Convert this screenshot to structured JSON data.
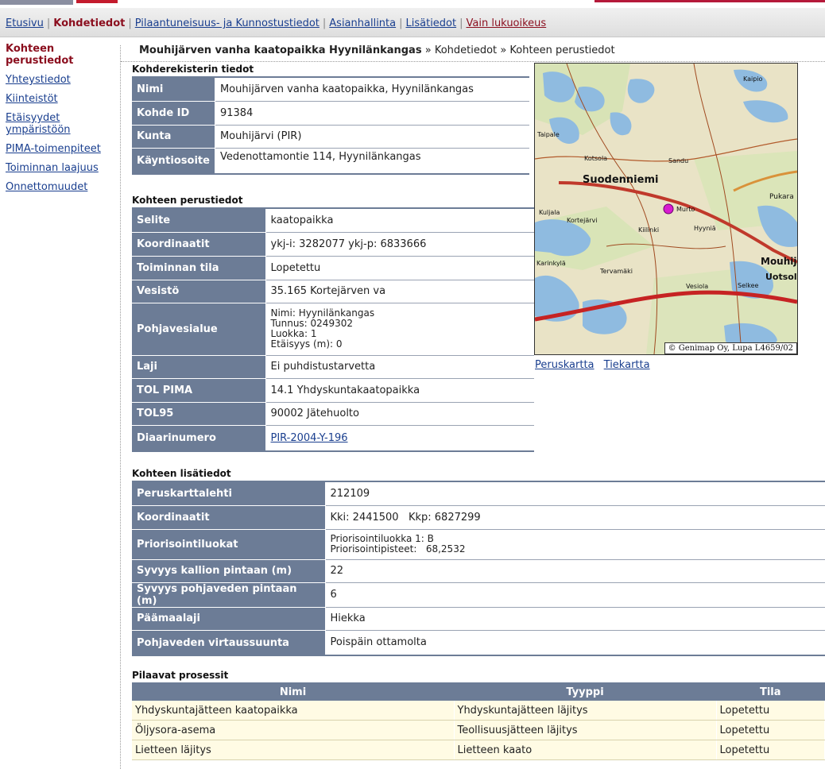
{
  "nav": {
    "items": [
      {
        "label": "Etusivu",
        "current": false
      },
      {
        "label": "Kohdetiedot",
        "current": true
      },
      {
        "label": "Pilaantuneisuus- ja Kunnostustiedot",
        "current": false
      },
      {
        "label": "Asianhallinta",
        "current": false
      },
      {
        "label": "Lisätiedot",
        "current": false
      },
      {
        "label": "Vain lukuoikeus",
        "current": false
      }
    ]
  },
  "sidebar": {
    "items": [
      {
        "label": "Kohteen perustiedot"
      },
      {
        "label": "Yhteystiedot"
      },
      {
        "label": "Kiinteistöt"
      },
      {
        "label": "Etäisyydet ympäristöön"
      },
      {
        "label": "PIMA-toimenpiteet"
      },
      {
        "label": "Toiminnan laajuus"
      },
      {
        "label": "Onnettomuudet"
      }
    ]
  },
  "breadcrumb": {
    "site": "Mouhijärven vanha kaatopaikka Hyynilänkangas",
    "sep": "»",
    "level1": "Kohdetiedot",
    "level2": "Kohteen perustiedot"
  },
  "register": {
    "title": "Kohderekisterin tiedot",
    "rows": [
      {
        "label": "Nimi",
        "value": "Mouhijärven vanha kaatopaikka, Hyynilänkangas"
      },
      {
        "label": "Kohde ID",
        "value": "91384"
      },
      {
        "label": "Kunta",
        "value": "Mouhijärvi (PIR)"
      },
      {
        "label": "Käyntiosoite",
        "value": "Vedenottamontie 114, Hyynilänkangas"
      }
    ]
  },
  "basic": {
    "title": "Kohteen perustiedot",
    "rows": [
      {
        "label": "Selite",
        "value": "kaatopaikka"
      },
      {
        "label": "Koordinaatit",
        "value": "ykj-i: 3282077 ykj-p: 6833666"
      },
      {
        "label": "Toiminnan tila",
        "value": "Lopetettu"
      },
      {
        "label": "Vesistö",
        "value": "35.165 Kortejärven va"
      },
      {
        "label": "Pohjavesialue",
        "lines": [
          "Nimi: Hyynilänkangas",
          "Tunnus: 0249302",
          "Luokka: 1",
          "Etäisyys (m): 0"
        ]
      },
      {
        "label": "Laji",
        "value": "Ei puhdistustarvetta"
      },
      {
        "label": "TOL PIMA",
        "value": "14.1 Yhdyskuntakaatopaikka"
      },
      {
        "label": "TOL95",
        "value": "90002 Jätehuolto"
      },
      {
        "label": "Diaarinumero",
        "value": "PIR-2004-Y-196"
      }
    ]
  },
  "map": {
    "copyright": "© Genimap Oy, Lupa L4659/02",
    "place_names": [
      "Suodenniemi",
      "Mouhijä",
      "Uotsola",
      "Kaipio",
      "Taipale",
      "Kortejärvi",
      "Tervamäki",
      "Hyyniä",
      "Karinkylä",
      "Vesiola",
      "Kiilinki",
      "Sandu",
      "Kotsola",
      "Selkee",
      "Kuljala",
      "Murto",
      "Pukara"
    ],
    "links": [
      "Peruskartta",
      "Tiekartta"
    ]
  },
  "extra": {
    "title": "Kohteen lisätiedot",
    "rows": [
      {
        "label": "Peruskarttalehti",
        "value": "212109"
      },
      {
        "label": "Koordinaatit",
        "value": "Kki: 2441500   Kkp: 6827299"
      },
      {
        "label": "Priorisointiluokat",
        "lines": [
          "Priorisointiluokka 1: B",
          "Priorisointipisteet:   68,2532"
        ]
      },
      {
        "label": "Syvyys kallion pintaan (m)",
        "value": "22"
      },
      {
        "label": "Syvyys pohjaveden pintaan (m)",
        "value": "6"
      },
      {
        "label": "Päämaalaji",
        "value": "Hiekka"
      },
      {
        "label": "Pohjaveden virtaussuunta",
        "value": "Poispäin ottamolta"
      }
    ]
  },
  "processes": {
    "title": "Pilaavat prosessit",
    "headers": [
      "Nimi",
      "Tyyppi",
      "Tila"
    ],
    "rows": [
      [
        "Yhdyskuntajätteen kaatopaikka",
        "Yhdyskuntajätteen läjitys",
        "Lopetettu"
      ],
      [
        "Öljysora-asema",
        "Teollisuusjätteen läjitys",
        "Lopetettu"
      ],
      [
        "Lietteen läjitys",
        "Lietteen kaato",
        "Lopetettu"
      ]
    ]
  },
  "colors": {
    "accent": "#8b0e1e",
    "header_bg": "#6c7c96",
    "link": "#1a3f8f",
    "process_row_bg": "#fffbe4"
  }
}
